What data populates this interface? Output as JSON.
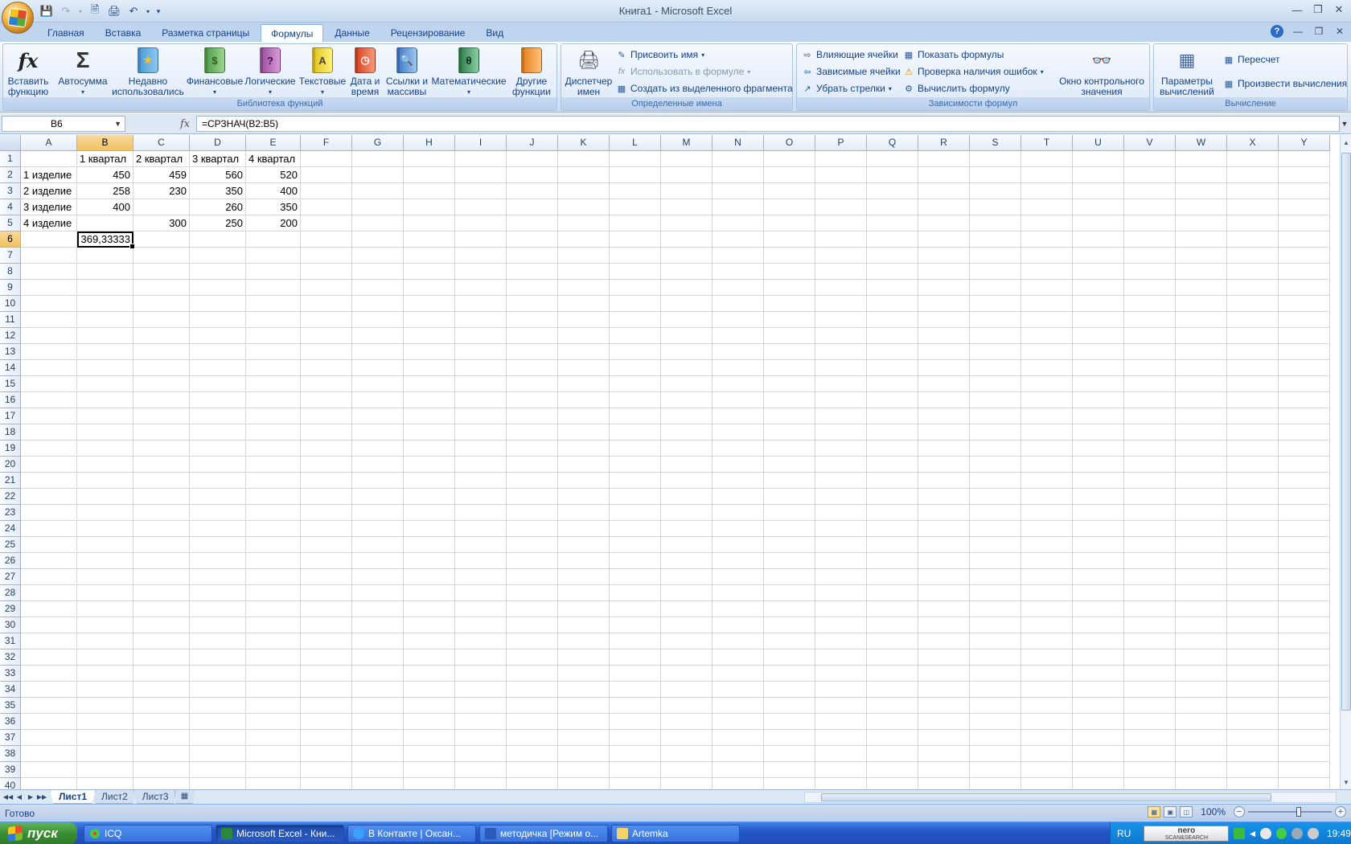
{
  "window": {
    "title": "Книга1 - Microsoft Excel"
  },
  "tabs": [
    {
      "label": "Главная"
    },
    {
      "label": "Вставка"
    },
    {
      "label": "Разметка страницы"
    },
    {
      "label": "Формулы"
    },
    {
      "label": "Данные"
    },
    {
      "label": "Рецензирование"
    },
    {
      "label": "Вид"
    }
  ],
  "ribbon": {
    "function_library": {
      "label": "Библиотека функций",
      "insert_function": [
        "Вставить",
        "функцию"
      ],
      "autosum": "Автосумма",
      "recent": [
        "Недавно",
        "использовались"
      ],
      "financial": "Финансовые",
      "logical": "Логические",
      "text": "Текстовые",
      "datetime": [
        "Дата и",
        "время"
      ],
      "lookup": [
        "Ссылки и",
        "массивы"
      ],
      "math": "Математические",
      "other": [
        "Другие",
        "функции"
      ]
    },
    "defined_names": {
      "label": "Определенные имена",
      "manager": [
        "Диспетчер",
        "имен"
      ],
      "assign_name": "Присвоить имя",
      "use_in_formula": "Использовать в формуле",
      "create_from_selection": "Создать из выделенного фрагмента"
    },
    "formula_auditing": {
      "label": "Зависимости формул",
      "trace_precedents": "Влияющие ячейки",
      "trace_dependents": "Зависимые ячейки",
      "remove_arrows": "Убрать стрелки",
      "show_formulas": "Показать формулы",
      "error_checking": "Проверка наличия ошибок",
      "evaluate_formula": "Вычислить формулу",
      "watch_window": [
        "Окно контрольного",
        "значения"
      ]
    },
    "calculation": {
      "label": "Вычисление",
      "options": [
        "Параметры",
        "вычислений"
      ],
      "calc_now": "Пересчет",
      "calc_sheet": "Произвести вычисления"
    }
  },
  "formula_bar": {
    "name_box": "B6",
    "fx": "fx",
    "formula": "=СРЗНАЧ(B2:B5)"
  },
  "grid": {
    "columns": [
      "A",
      "B",
      "C",
      "D",
      "E",
      "F",
      "G",
      "H",
      "I",
      "J",
      "K",
      "L",
      "M",
      "N",
      "O",
      "P",
      "Q",
      "R",
      "S",
      "T",
      "U",
      "V",
      "W",
      "X",
      "Y"
    ],
    "selected_column": "B",
    "selected_row": 6,
    "row_count": 40,
    "rows": [
      [
        "",
        "1 квартал",
        "2 квартал",
        "3 квартал",
        "4 квартал"
      ],
      [
        "1 изделие",
        "450",
        "459",
        "560",
        "520"
      ],
      [
        "2 изделие",
        "258",
        "230",
        "350",
        "400"
      ],
      [
        "3 изделие",
        "400",
        "",
        "260",
        "350"
      ],
      [
        "4 изделие",
        "",
        "300",
        "250",
        "200"
      ],
      [
        "",
        "369,33333",
        "",
        "",
        ""
      ]
    ]
  },
  "sheets": [
    "Лист1",
    "Лист2",
    "Лист3"
  ],
  "status": {
    "text": "Готово",
    "zoom": "100%"
  },
  "taskbar": {
    "start": "пуск",
    "items": [
      "ICQ",
      "Microsoft Excel - Кни...",
      "В Контакте | Оксан...",
      "методичка [Режим о...",
      "Artemka"
    ],
    "lang": "RU",
    "search": [
      "nero",
      "SCAN&SEARCH"
    ],
    "clock": "19:49"
  }
}
